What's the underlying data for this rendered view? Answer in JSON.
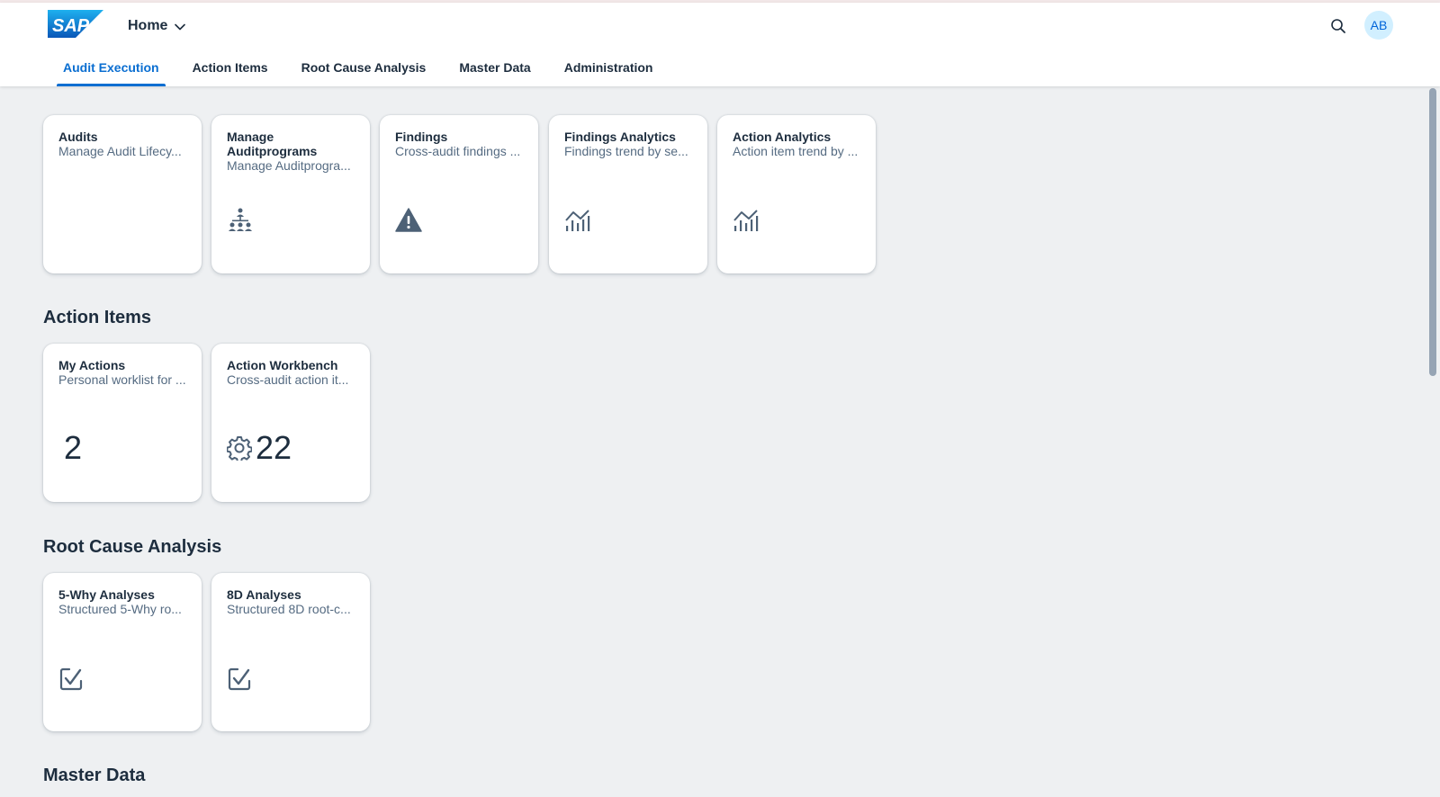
{
  "header": {
    "logo_text": "SAP",
    "home_label": "Home",
    "avatar_initials": "AB"
  },
  "tabs": [
    {
      "label": "Audit Execution",
      "active": true
    },
    {
      "label": "Action Items"
    },
    {
      "label": "Root Cause Analysis"
    },
    {
      "label": "Master Data"
    },
    {
      "label": "Administration"
    }
  ],
  "audit_execution": {
    "tiles": [
      {
        "title": "Audits",
        "subtitle": "Manage Audit Lifecy..."
      },
      {
        "title": "Manage Auditprograms",
        "subtitle": "Manage Auditprogra...",
        "icon": "org-chart-icon"
      },
      {
        "title": "Findings",
        "subtitle": "Cross-audit findings ...",
        "icon": "warning-icon"
      },
      {
        "title": "Findings Analytics",
        "subtitle": "Findings trend by se...",
        "icon": "line-chart-icon"
      },
      {
        "title": "Action Analytics",
        "subtitle": "Action item trend by ...",
        "icon": "line-chart-icon"
      }
    ]
  },
  "action_items": {
    "title": "Action Items",
    "tiles": [
      {
        "title": "My Actions",
        "subtitle": "Personal worklist for ...",
        "kpi": "2"
      },
      {
        "title": "Action Workbench",
        "subtitle": "Cross-audit action it...",
        "kpi": "22",
        "icon": "gear-icon"
      }
    ]
  },
  "root_cause": {
    "title": "Root Cause Analysis",
    "tiles": [
      {
        "title": "5-Why Analyses",
        "subtitle": "Structured 5-Why ro...",
        "icon": "checkbox-icon"
      },
      {
        "title": "8D Analyses",
        "subtitle": "Structured 8D root-c...",
        "icon": "checkbox-icon"
      }
    ]
  },
  "master_data": {
    "title": "Master Data"
  },
  "colors": {
    "accent": "#0a6ed1",
    "background": "#eef0f2",
    "text": "#1d2d3e",
    "subtext": "#556b82",
    "icon": "#4d6176"
  }
}
